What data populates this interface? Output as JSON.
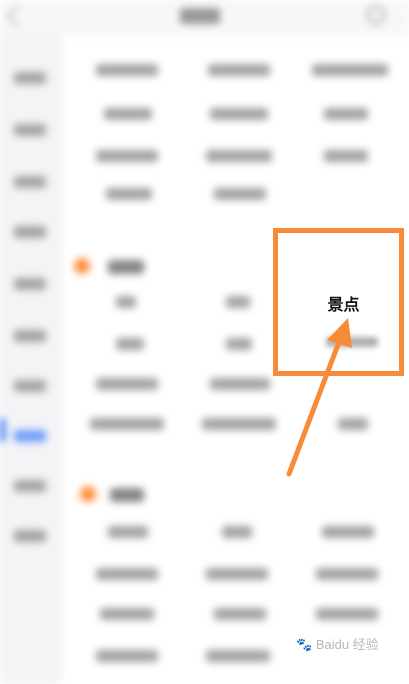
{
  "highlight": {
    "label": "景点"
  },
  "watermark": {
    "text": "Baidu 经验"
  },
  "colors": {
    "accent": "#f78b3a",
    "sidebar_active": "#3777ff",
    "section_dot": "#ff8d3a"
  },
  "icons": {
    "back": "back-icon",
    "search": "search-icon",
    "arrow": "arrow-icon",
    "watermark": "baidu-paw-icon"
  }
}
